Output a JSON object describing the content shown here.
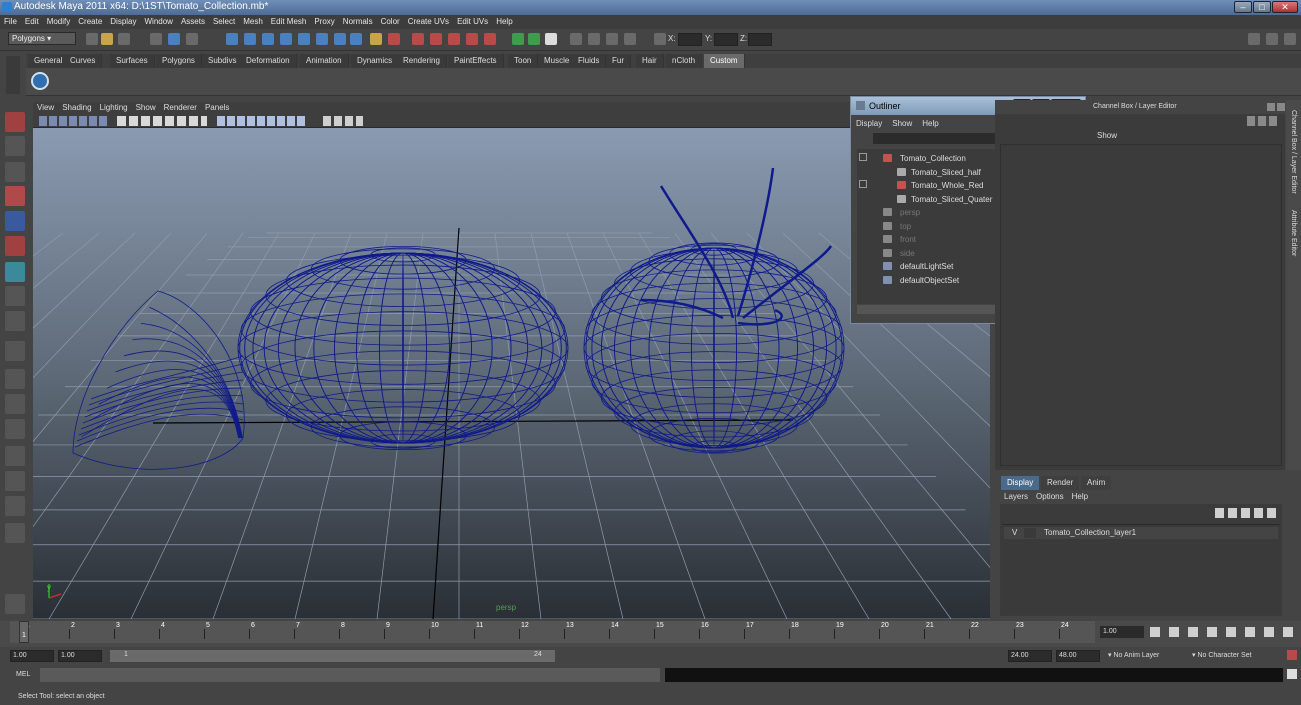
{
  "window": {
    "title": "Autodesk Maya 2011 x64: D:\\1ST\\Tomato_Collection.mb*"
  },
  "menus": [
    "File",
    "Edit",
    "Modify",
    "Create",
    "Display",
    "Window",
    "Assets",
    "Select",
    "Mesh",
    "Edit Mesh",
    "Proxy",
    "Normals",
    "Color",
    "Create UVs",
    "Edit UVs",
    "Help"
  ],
  "status": {
    "mode": "Polygons",
    "x_label": "X:",
    "y_label": "Y:",
    "z_label": "Z:"
  },
  "shelf_tabs": [
    "General",
    "Curves",
    "Surfaces",
    "Polygons",
    "Subdivs",
    "Deformation",
    "Animation",
    "Dynamics",
    "Rendering",
    "PaintEffects",
    "Toon",
    "Muscle",
    "Fluids",
    "Fur",
    "Hair",
    "nCloth",
    "Custom"
  ],
  "active_shelf": "Custom",
  "panel_menu": [
    "View",
    "Shading",
    "Lighting",
    "Show",
    "Renderer",
    "Panels"
  ],
  "viewport": {
    "camera_label": "persp"
  },
  "outliner": {
    "title": "Outliner",
    "menu": [
      "Display",
      "Show",
      "Help"
    ],
    "items": [
      {
        "label": "Tomato_Collection",
        "icon": "group-icon",
        "dim": false
      },
      {
        "label": "Tomato_Sliced_half",
        "icon": "mesh-icon",
        "dim": false
      },
      {
        "label": "Tomato_Whole_Red",
        "icon": "group-icon",
        "dim": false
      },
      {
        "label": "Tomato_Sliced_Quater",
        "icon": "mesh-icon",
        "dim": false
      },
      {
        "label": "persp",
        "icon": "camera-icon",
        "dim": true
      },
      {
        "label": "top",
        "icon": "camera-icon",
        "dim": true
      },
      {
        "label": "front",
        "icon": "camera-icon",
        "dim": true
      },
      {
        "label": "side",
        "icon": "camera-icon",
        "dim": true
      },
      {
        "label": "defaultLightSet",
        "icon": "set-icon",
        "dim": false
      },
      {
        "label": "defaultObjectSet",
        "icon": "set-icon",
        "dim": false
      }
    ]
  },
  "channel_box": {
    "title": "Channel Box / Layer Editor",
    "show_label": "Show"
  },
  "side_tabs": {
    "channel": "Channel Box / Layer Editor",
    "attribute": "Attribute Editor"
  },
  "layer_editor": {
    "tabs": [
      "Display",
      "Render",
      "Anim"
    ],
    "active_tab": "Display",
    "menu": [
      "Layers",
      "Options",
      "Help"
    ],
    "layer": {
      "visible": "V",
      "name": "Tomato_Collection_layer1"
    }
  },
  "timeline": {
    "ticks": [
      "1",
      "2",
      "3",
      "4",
      "5",
      "6",
      "7",
      "8",
      "9",
      "10",
      "11",
      "12",
      "13",
      "14",
      "15",
      "16",
      "17",
      "18",
      "19",
      "20",
      "21",
      "22",
      "23",
      "24"
    ],
    "current_frame": "1.00",
    "current_marker": "1"
  },
  "range": {
    "start": "1.00",
    "start2": "1.00",
    "slider_start": "1",
    "slider_end": "24",
    "end": "24.00",
    "end2": "48.00",
    "anim_layer": "No Anim Layer",
    "character_set": "No Character Set"
  },
  "command": {
    "label": "MEL"
  },
  "help_line": "Select Tool: select an object",
  "colors": {
    "wire": "#0f1a8c",
    "viewport_top": "#8a9ab0",
    "viewport_bottom": "#2a2f35"
  }
}
